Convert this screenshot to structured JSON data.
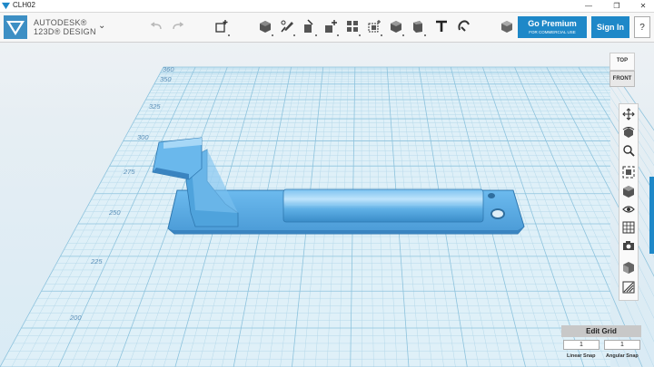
{
  "window": {
    "title": "CLH02"
  },
  "brand": {
    "line1": "AUTODESK®",
    "line2": "123D® DESIGN"
  },
  "header": {
    "premium_label": "Go Premium",
    "premium_sub": "FOR COMMERCIAL USE",
    "signin_label": "Sign In",
    "help_label": "?"
  },
  "toolbar_icons": [
    "undo-icon",
    "redo-icon",
    "transform-icon",
    "primitives-icon",
    "sketch-icon",
    "construct-icon",
    "modify-icon",
    "pattern-icon",
    "grouping-icon",
    "combine-icon",
    "measure-icon",
    "text-icon",
    "snap-icon",
    "materials-icon"
  ],
  "grid_labels": [
    "360",
    "350",
    "325",
    "300",
    "275",
    "250",
    "225",
    "200"
  ],
  "viewcube": {
    "top": "TOP",
    "front": "FRONT"
  },
  "colors": {
    "accent": "#1e88c8",
    "model": "#5aaee8",
    "grid": "#a9d3e8"
  },
  "edit_grid": {
    "label": "Edit Grid",
    "linear_value": "1",
    "angular_value": "1",
    "linear_label": "Linear Snap",
    "angular_label": "Angular Snap"
  }
}
